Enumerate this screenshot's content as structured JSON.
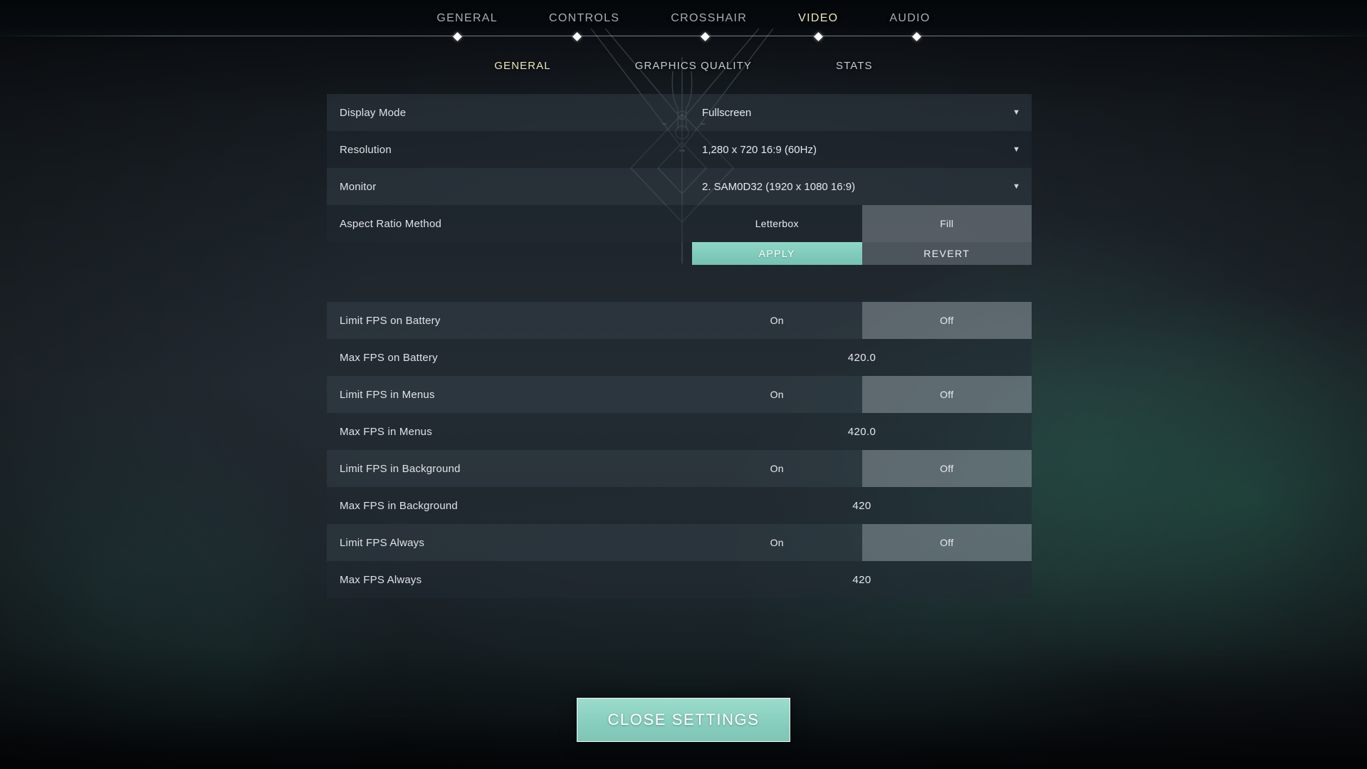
{
  "topnav": {
    "items": [
      {
        "label": "GENERAL",
        "active": false
      },
      {
        "label": "CONTROLS",
        "active": false
      },
      {
        "label": "CROSSHAIR",
        "active": false
      },
      {
        "label": "VIDEO",
        "active": true
      },
      {
        "label": "AUDIO",
        "active": false
      }
    ]
  },
  "subtabs": {
    "items": [
      {
        "label": "GENERAL",
        "active": true
      },
      {
        "label": "GRAPHICS QUALITY",
        "active": false
      },
      {
        "label": "STATS",
        "active": false
      }
    ]
  },
  "display_group": {
    "rows": [
      {
        "label": "Display Mode",
        "type": "dropdown",
        "value": "Fullscreen",
        "caret": "▼"
      },
      {
        "label": "Resolution",
        "type": "dropdown",
        "value": "1,280 x 720 16:9 (60Hz)",
        "caret": "▼"
      },
      {
        "label": "Monitor",
        "type": "dropdown",
        "value": "2. SAM0D32 (1920 x  1080 16:9)",
        "caret": "▼"
      },
      {
        "label": "Aspect Ratio Method",
        "type": "toggle",
        "option_a": "Letterbox",
        "option_b": "Fill",
        "selected": "Fill"
      }
    ],
    "apply_label": "APPLY",
    "revert_label": "REVERT"
  },
  "fps_group": {
    "rows": [
      {
        "label": "Limit FPS on Battery",
        "type": "toggle",
        "option_a": "On",
        "option_b": "Off",
        "selected": "Off"
      },
      {
        "label": "Max FPS on Battery",
        "type": "value",
        "value": "420.0"
      },
      {
        "label": "Limit FPS in Menus",
        "type": "toggle",
        "option_a": "On",
        "option_b": "Off",
        "selected": "Off"
      },
      {
        "label": "Max FPS in Menus",
        "type": "value",
        "value": "420.0"
      },
      {
        "label": "Limit FPS in Background",
        "type": "toggle",
        "option_a": "On",
        "option_b": "Off",
        "selected": "Off"
      },
      {
        "label": "Max FPS in Background",
        "type": "value",
        "value": "420"
      },
      {
        "label": "Limit FPS Always",
        "type": "toggle",
        "option_a": "On",
        "option_b": "Off",
        "selected": "Off"
      },
      {
        "label": "Max FPS Always",
        "type": "value",
        "value": "420"
      }
    ]
  },
  "footer": {
    "close_label": "CLOSE SETTINGS"
  },
  "colors": {
    "accent_active_tab": "#ece8bd",
    "accent_apply": "#82cdbc",
    "accent_close": "#8dd2c2",
    "row_odd": "#3a444f",
    "row_even": "#212932",
    "toggle_selected": "#bec6cd"
  }
}
